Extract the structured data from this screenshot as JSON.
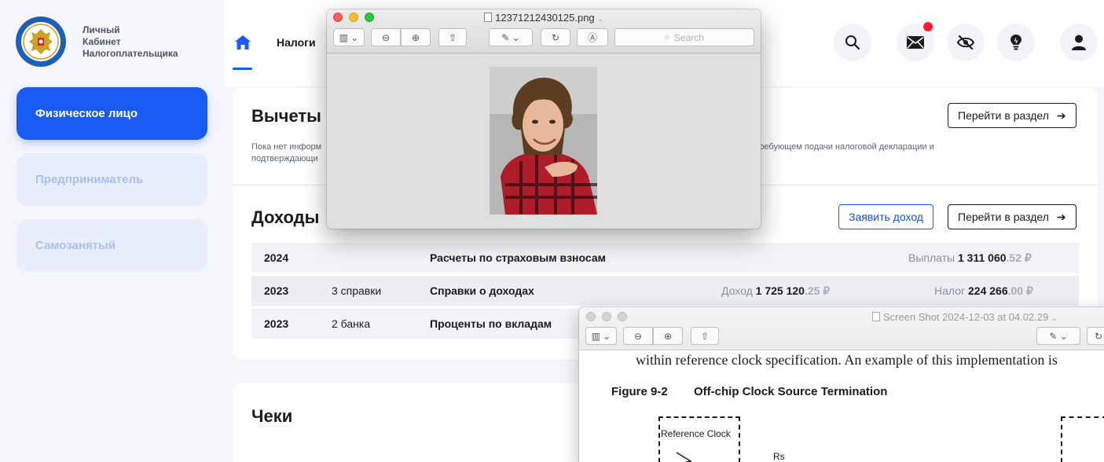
{
  "sidebar": {
    "brand_line1": "Личный",
    "brand_line2": "Кабинет",
    "brand_line3": "Налогоплательщика",
    "items": [
      {
        "label": "Физическое лицо",
        "active": true
      },
      {
        "label": "Предприниматель",
        "active": false
      },
      {
        "label": "Самозанятый",
        "active": false
      }
    ]
  },
  "topnav": {
    "home_icon": "home-icon",
    "taxes_label": "Налоги",
    "icons": [
      "search-icon",
      "mail-icon",
      "eye-off-icon",
      "lightbulb-icon",
      "user-icon"
    ]
  },
  "deductions": {
    "title": "Вычеты",
    "text": "Пока нет информ                                                                                                                                                                  орядке, не требующем подачи налоговой декларации и",
    "text_line2": "подтверждающи",
    "go_label": "Перейти в раздел"
  },
  "income": {
    "title": "Доходы",
    "declare_label": "Заявить доход",
    "go_label": "Перейти в раздел",
    "rows": [
      {
        "year": "2024",
        "count": "",
        "name": "Расчеты по страховым взносам",
        "mid_label": "",
        "mid_int": "",
        "mid_cents": "",
        "right_label": "Выплаты",
        "right_int": "1 311 060",
        "right_cents": ".52 ₽"
      },
      {
        "year": "2023",
        "count": "3 справки",
        "name": "Справки о доходах",
        "mid_label": "Доход",
        "mid_int": "1 725 120",
        "mid_cents": ".25 ₽",
        "right_label": "Налог",
        "right_int": "224 266",
        "right_cents": ".00 ₽"
      },
      {
        "year": "2023",
        "count": "2 банка",
        "name": "Проценты по вкладам",
        "mid_label": "",
        "mid_int": "",
        "mid_cents": "",
        "right_label": "",
        "right_int": "",
        "right_cents": ""
      }
    ]
  },
  "checks": {
    "title": "Чеки"
  },
  "preview_photo": {
    "title": "12371212430125.png",
    "search_placeholder": "Search"
  },
  "preview_doc": {
    "title": "Screen Shot 2024-12-03 at 04.02.29",
    "text_line": "within reference clock specification. An example of this implementation is",
    "figure_number": "Figure 9-2",
    "figure_caption": "Off-chip Clock Source Termination",
    "ref_clock_label": "Reference Clock",
    "rs_label": "Rs"
  },
  "colors": {
    "accent": "#1a5bf5",
    "notification": "#ff1a2d"
  }
}
